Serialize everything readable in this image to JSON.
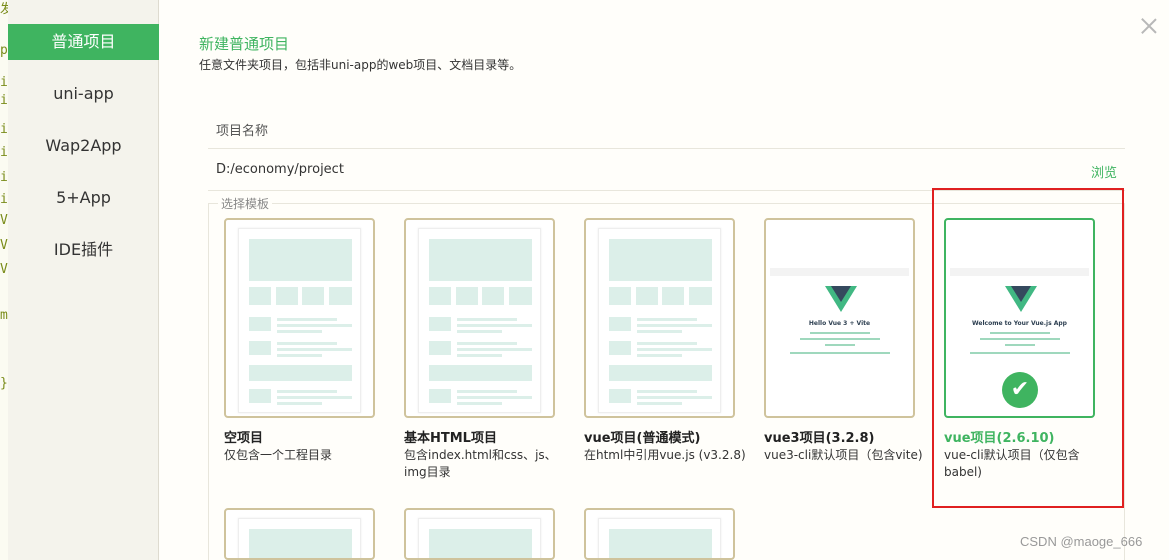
{
  "editor_strip": [
    "发",
    "p",
    "i",
    "i",
    "i",
    "i",
    "i",
    "i",
    "V",
    "V",
    "V",
    "m",
    "}"
  ],
  "sidebar": {
    "items": [
      {
        "label": "普通项目",
        "active": true
      },
      {
        "label": "uni-app",
        "active": false
      },
      {
        "label": "Wap2App",
        "active": false
      },
      {
        "label": "5+App",
        "active": false
      },
      {
        "label": "IDE插件",
        "active": false
      }
    ]
  },
  "dialog": {
    "title": "新建普通项目",
    "subtitle": "任意文件夹项目，包括非uni-app的web项目、文档目录等。",
    "name_placeholder": "项目名称",
    "path_value": "D:/economy/project",
    "browse_label": "浏览",
    "template_legend": "选择模板"
  },
  "templates": [
    {
      "name": "空项目",
      "desc": "仅包含一个工程目录",
      "preview": "wireframe",
      "selected": false
    },
    {
      "name": "基本HTML项目",
      "desc": "包含index.html和css、js、img目录",
      "preview": "wireframe",
      "selected": false
    },
    {
      "name": "vue项目(普通模式)",
      "desc": "在html中引用vue.js (v3.2.8)",
      "preview": "wireframe",
      "selected": false
    },
    {
      "name": "vue3项目(3.2.8)",
      "desc": "vue3-cli默认项目（包含vite)",
      "preview": "vue",
      "preview_title": "Hello Vue 3 + Vite",
      "selected": false
    },
    {
      "name": "vue项目(2.6.10)",
      "desc": "vue-cli默认项目（仅包含babel)",
      "preview": "vue",
      "preview_title": "Welcome to Your Vue.js App",
      "selected": true
    }
  ],
  "check_icon": "✔",
  "watermark": "CSDN @maoge_666",
  "colors": {
    "accent": "#3fb460",
    "card_border": "#cfc39c",
    "highlight": "#e02020"
  }
}
